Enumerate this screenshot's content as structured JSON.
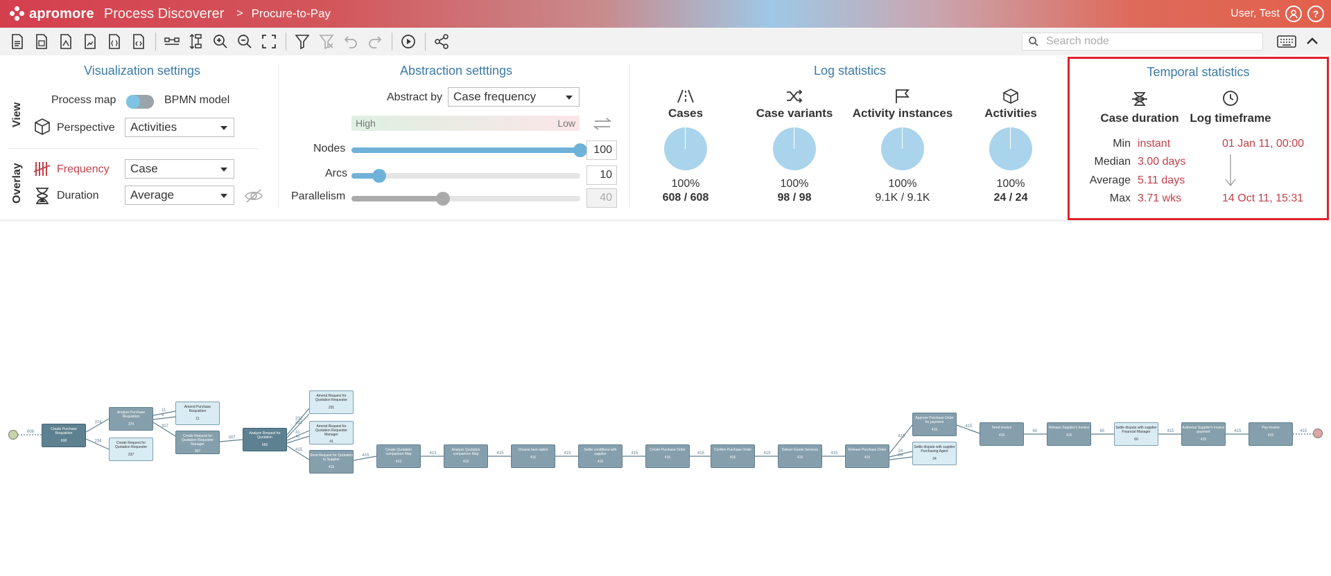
{
  "header": {
    "logo_text": "apromore",
    "app_name": "Process Discoverer",
    "breadcrumb_sep": ">",
    "breadcrumb": "Procure-to-Pay",
    "user": "User, Test",
    "help_glyph": "?"
  },
  "toolbar": {
    "search_placeholder": "Search node",
    "icons": [
      "save-log-icon",
      "export-icon",
      "export-pdf-icon",
      "export-image-icon",
      "export-json-icon",
      "export-code-icon",
      "layout-horizontal-icon",
      "layout-vertical-icon",
      "zoom-in-icon",
      "zoom-out-icon",
      "fit-screen-icon",
      "filter-icon",
      "clear-filter-icon",
      "undo-icon",
      "redo-icon",
      "animate-icon",
      "share-icon",
      "keyboard-icon",
      "chevron-up-icon"
    ]
  },
  "visualization": {
    "title": "Visualization settings",
    "view_label": "View",
    "process_map": "Process map",
    "bpmn_model": "BPMN model",
    "perspective_label": "Perspective",
    "perspective_value": "Activities",
    "overlay_label": "Overlay",
    "frequency_label": "Frequency",
    "frequency_value": "Case",
    "duration_label": "Duration",
    "duration_value": "Average"
  },
  "abstraction": {
    "title": "Abstraction setttings",
    "abstract_by_label": "Abstract by",
    "abstract_by_value": "Case frequency",
    "gradient_high": "High",
    "gradient_low": "Low",
    "nodes_label": "Nodes",
    "nodes_value": "100",
    "nodes_level": 1.0,
    "arcs_label": "Arcs",
    "arcs_value": "10",
    "arcs_level": 0.12,
    "parallelism_label": "Parallelism",
    "parallelism_value": "40",
    "parallelism_level": 0.4
  },
  "log_statistics": {
    "title": "Log statistics",
    "items": [
      {
        "name": "Cases",
        "pct": "100%",
        "count": "608 / 608",
        "bold": true
      },
      {
        "name": "Case variants",
        "pct": "100%",
        "count": "98 / 98",
        "bold": true
      },
      {
        "name": "Activity instances",
        "pct": "100%",
        "count": "9.1K / 9.1K",
        "bold": false
      },
      {
        "name": "Activities",
        "pct": "100%",
        "count": "24 / 24",
        "bold": true
      }
    ]
  },
  "temporal": {
    "title": "Temporal statistics",
    "case_duration": "Case duration",
    "log_timeframe": "Log timeframe",
    "min_label": "Min",
    "min_value": "instant",
    "median_label": "Median",
    "median_value": "3.00 days",
    "average_label": "Average",
    "average_value": "5.11 days",
    "max_label": "Max",
    "max_value": "3.71 wks",
    "start": "01 Jan 11, 00:00",
    "end": "14 Oct 11, 15:31"
  },
  "process_map": {
    "start_count": "608",
    "end_count": "415",
    "nodes": [
      {
        "label": "Create Purchase Requisition",
        "count": "608",
        "style": "dark"
      },
      {
        "label": "Analyze Purchase Requisition",
        "count": "374",
        "style": "normal"
      },
      {
        "label": "Create Request for Quotation Requester",
        "count": "237",
        "style": "light"
      },
      {
        "label": "Amend Purchase Requisition",
        "count": "11",
        "style": "light"
      },
      {
        "label": "Create Request for Quotation Requester Manager",
        "count": "307",
        "style": "normal"
      },
      {
        "label": "Analyze Request for Quotation",
        "count": "656",
        "style": "dark"
      },
      {
        "label": "Amend Request for Quotation Requester",
        "count": "231",
        "style": "light"
      },
      {
        "label": "Amend Request for Quotation Requester Manager",
        "count": "41",
        "style": "light"
      },
      {
        "label": "Send Request for Quotation to Supplier",
        "count": "415",
        "style": "normal"
      },
      {
        "label": "Create Quotation comparison Map",
        "count": "413",
        "style": "normal"
      },
      {
        "label": "Analyze Quotation comparison Map",
        "count": "413",
        "style": "normal"
      },
      {
        "label": "Choose best option",
        "count": "415",
        "style": "normal"
      },
      {
        "label": "Settle conditions with supplier",
        "count": "415",
        "style": "normal"
      },
      {
        "label": "Create Purchase Order",
        "count": "415",
        "style": "normal"
      },
      {
        "label": "Confirm Purchase Order",
        "count": "415",
        "style": "normal"
      },
      {
        "label": "Deliver Goods Services",
        "count": "415",
        "style": "normal"
      },
      {
        "label": "Release Purchase Order",
        "count": "415",
        "style": "normal"
      },
      {
        "label": "Approve Purchase Order for payment",
        "count": "415",
        "style": "normal"
      },
      {
        "label": "Settle dispute with supplier Purchasing Agent",
        "count": "24",
        "style": "light"
      },
      {
        "label": "Send invoice",
        "count": "415",
        "style": "normal"
      },
      {
        "label": "Release Supplier's Invoice",
        "count": "415",
        "style": "normal"
      },
      {
        "label": "Settle dispute with supplier Financial Manager",
        "count": "60",
        "style": "light"
      },
      {
        "label": "Authorize Supplier's invoice payment",
        "count": "415",
        "style": "normal"
      },
      {
        "label": "Pay invoice",
        "count": "415",
        "style": "normal"
      }
    ],
    "edges": [
      "374",
      "234",
      "11",
      "9",
      "307",
      "307",
      "231",
      "231",
      "41",
      "41",
      "415",
      "415",
      "413",
      "415",
      "415",
      "415",
      "415",
      "415",
      "415",
      "24",
      "24",
      "415",
      "60",
      "60",
      "415",
      "415"
    ],
    "colors": {
      "node": "#869fac",
      "node_dark": "#5e8191",
      "node_light": "#d9ebf3",
      "start": "#c8d4a8",
      "end": "#e0a6a6"
    }
  },
  "colors": {
    "accent": "#3a7aa8",
    "danger": "#c0404a",
    "highlight": "#e0202a",
    "slider": "#6fb2d8"
  }
}
